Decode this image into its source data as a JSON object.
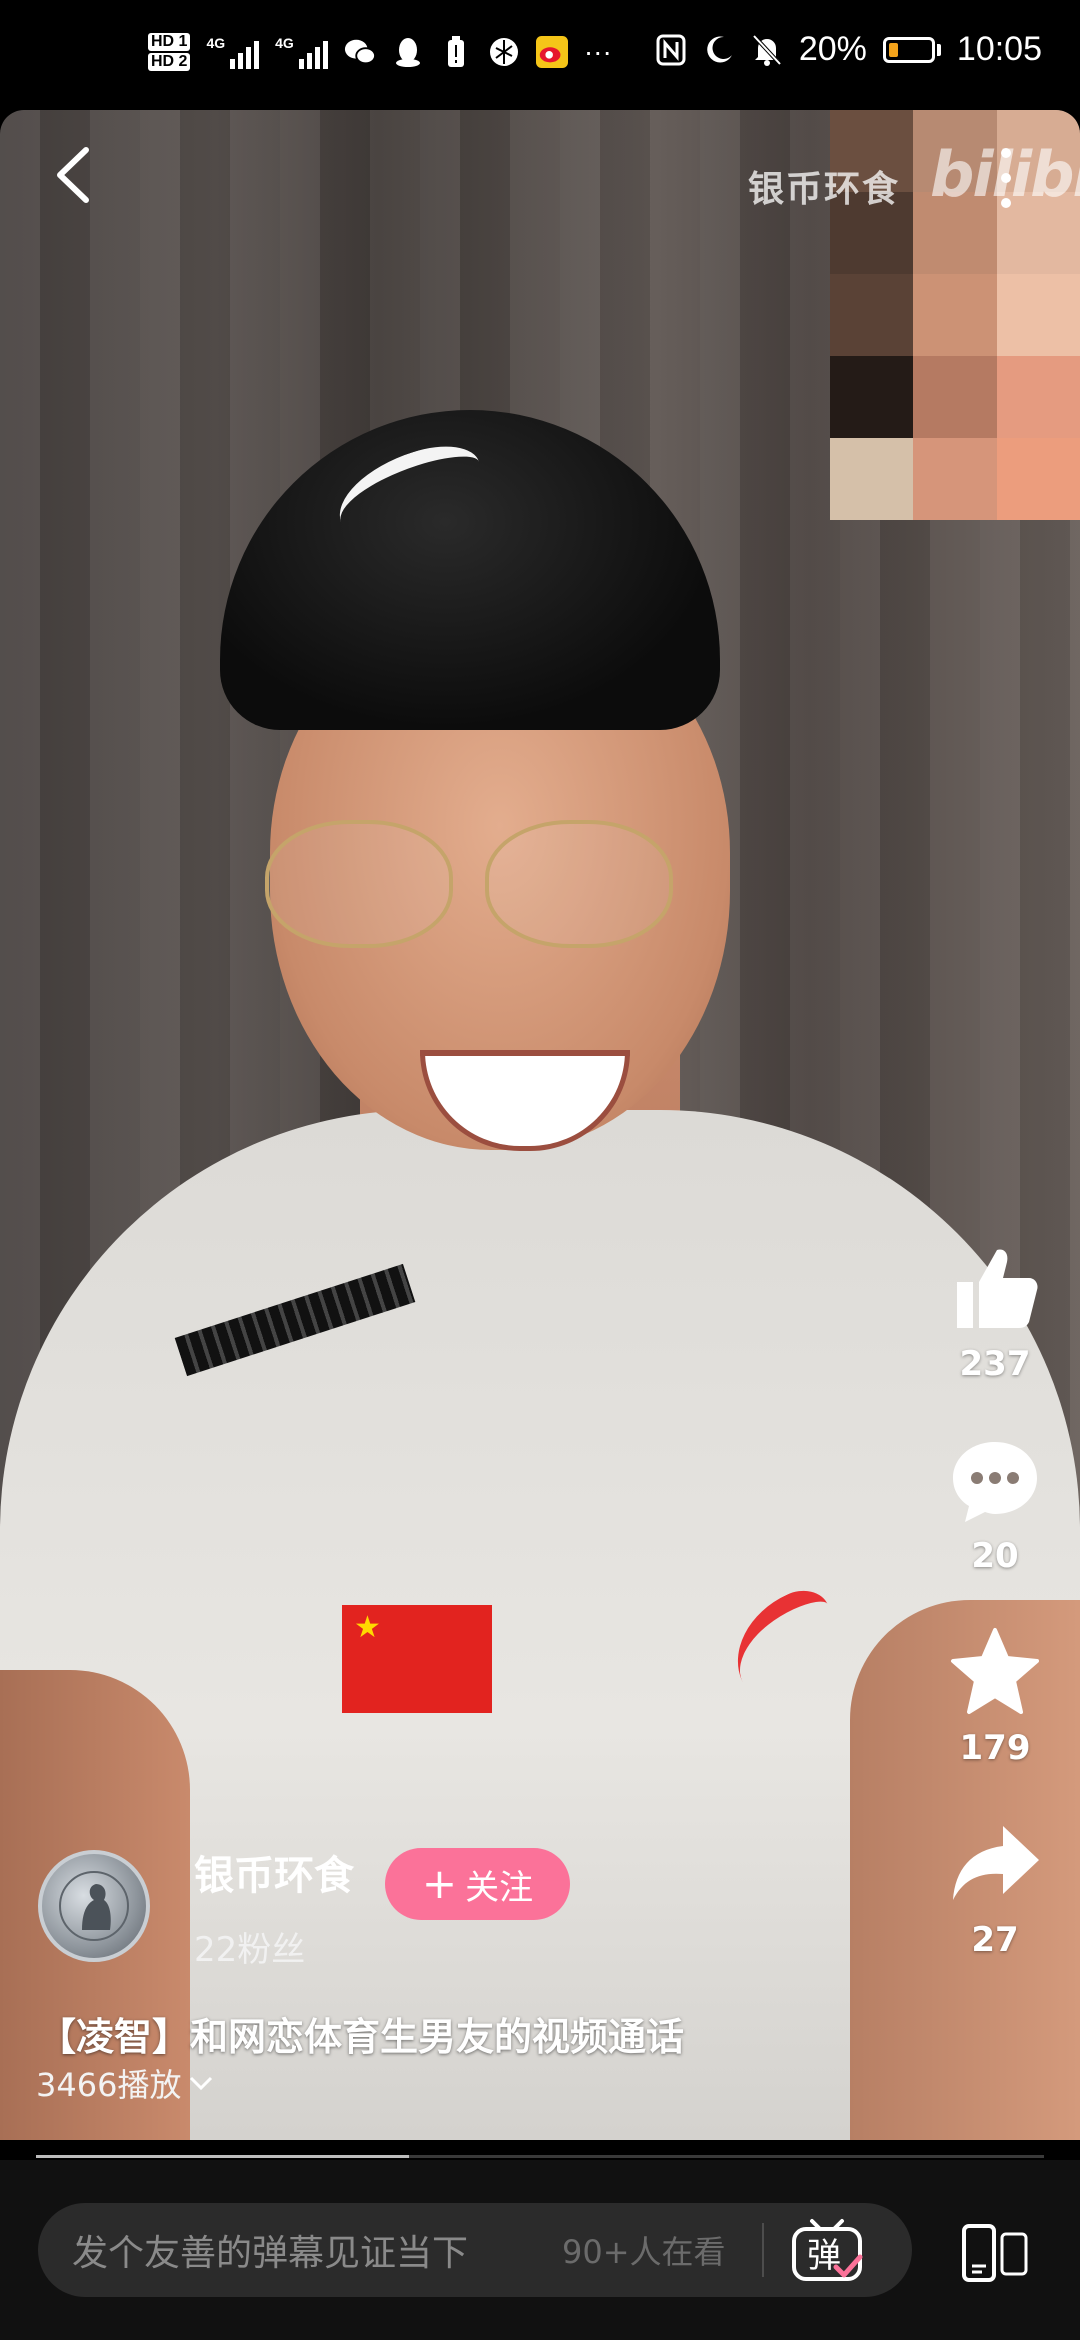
{
  "status_bar": {
    "hd1": "HD 1",
    "hd2": "HD 2",
    "net1": "4G",
    "net2": "4G",
    "more": "···",
    "battery_pct": "20%",
    "time": "10:05",
    "icons": [
      "wechat-icon",
      "qq-icon",
      "battery-alert-icon",
      "app-icon",
      "weibo-icon",
      "nfc-icon",
      "moon-icon",
      "mute-bell-icon"
    ]
  },
  "video": {
    "watermark_text": "银币环食",
    "watermark_logo": "bilibili"
  },
  "actions": {
    "like_count": "237",
    "comment_count": "20",
    "favorite_count": "179",
    "share_count": "27"
  },
  "author": {
    "name": "银币环食",
    "fans": "22粉丝",
    "follow_label": "关注"
  },
  "video_info": {
    "title": "【凌智】和网恋体育生男友的视频通话",
    "plays": "3466播放"
  },
  "progress": {
    "played_fraction": 0.37
  },
  "bottom_bar": {
    "danmaku_placeholder": "发个友善的弹幕见证当下",
    "watching": "90+人在看",
    "danmaku_toggle_label": "弹"
  },
  "colors": {
    "accent": "#fb7299",
    "battery_low": "#f3a31b"
  }
}
